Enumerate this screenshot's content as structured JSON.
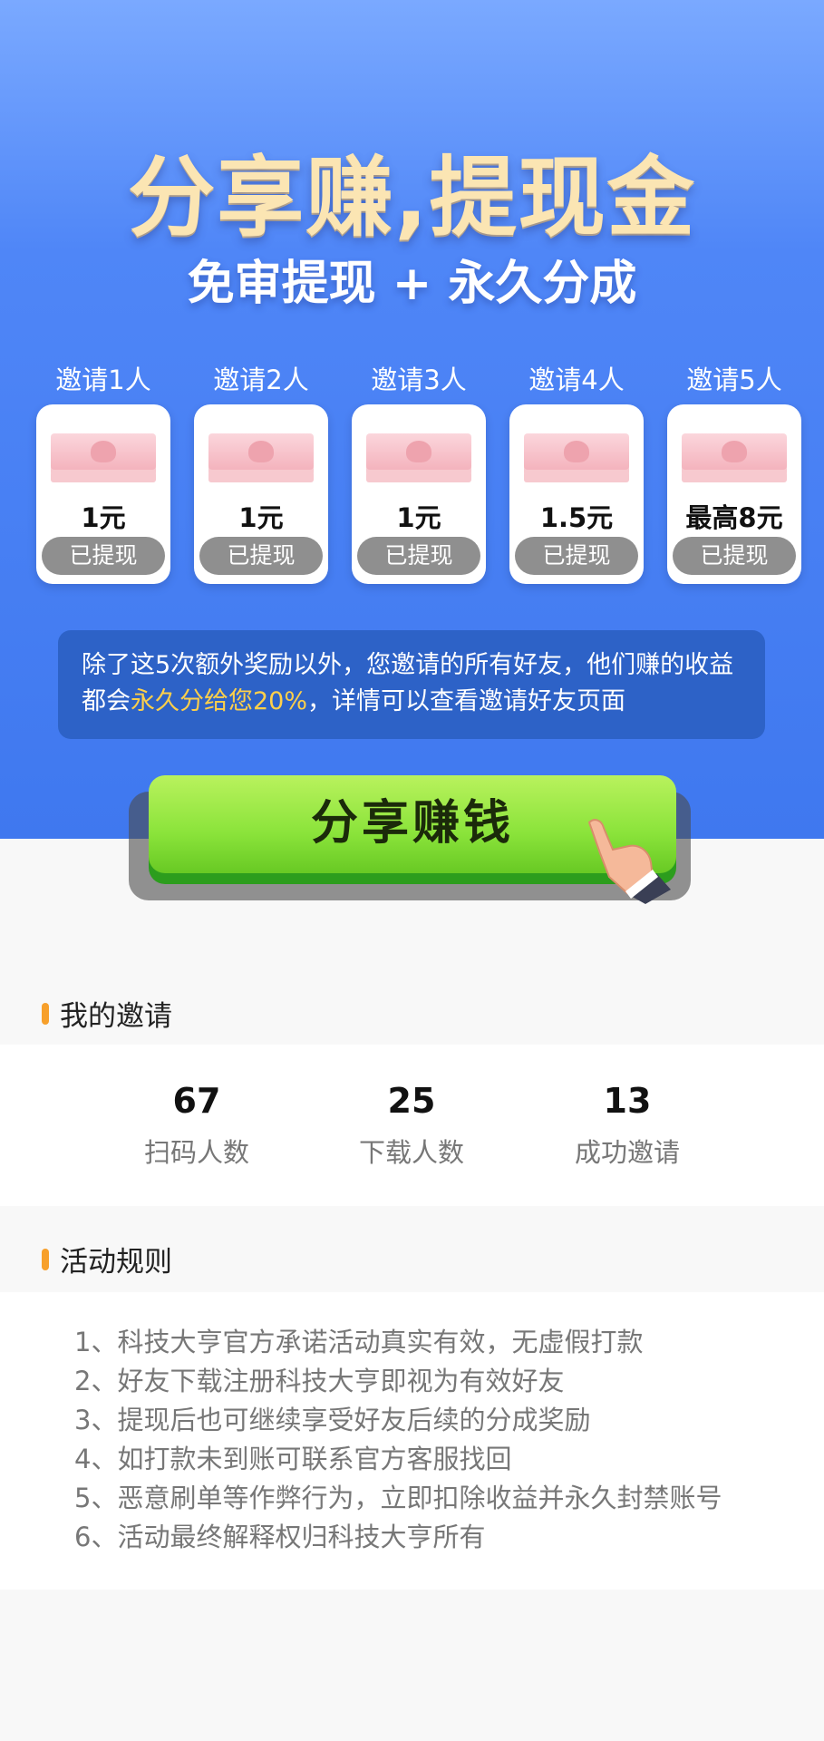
{
  "hero": {
    "headline": "分享赚,提现金",
    "subhead": "免审提现 + 永久分成"
  },
  "tiers": [
    {
      "label": "邀请1人",
      "amount": "1元",
      "status": "已提现"
    },
    {
      "label": "邀请2人",
      "amount": "1元",
      "status": "已提现"
    },
    {
      "label": "邀请3人",
      "amount": "1元",
      "status": "已提现"
    },
    {
      "label": "邀请4人",
      "amount": "1.5元",
      "status": "已提现"
    },
    {
      "label": "邀请5人",
      "amount": "最高8元",
      "status": "已提现"
    }
  ],
  "note": {
    "part1": "除了这5次额外奖励以外，您邀请的所有好友，他们赚的收益都会",
    "highlight": "永久分给您20%",
    "part2": "，详情可以查看邀请好友页面"
  },
  "cta": {
    "label": "分享赚钱"
  },
  "my_invites": {
    "title": "我的邀请",
    "stats": [
      {
        "value": "67",
        "label": "扫码人数"
      },
      {
        "value": "25",
        "label": "下载人数"
      },
      {
        "value": "13",
        "label": "成功邀请"
      }
    ]
  },
  "rules": {
    "title": "活动规则",
    "items": [
      "1、科技大亨官方承诺活动真实有效，无虚假打款",
      "2、好友下载注册科技大亨即视为有效好友",
      "3、提现后也可继续享受好友后续的分成奖励",
      "4、如打款未到账可联系官方客服找回",
      "5、恶意刷单等作弊行为，立即扣除收益并永久封禁账号",
      "6、活动最终解释权归科技大亨所有"
    ]
  },
  "colors": {
    "accent": "#f7a02b",
    "hero_blue": "#4f86f7",
    "cta_green": "#8ae33a",
    "highlight": "#ffd04a"
  },
  "icons": [
    "money-stack-icon",
    "pointing-hand-icon",
    "section-marker-icon"
  ]
}
